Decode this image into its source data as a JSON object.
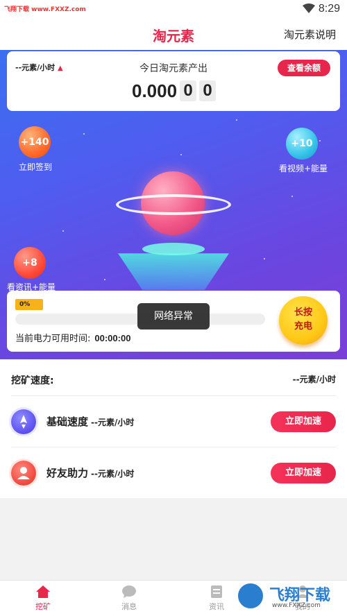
{
  "status_bar": {
    "watermark": "飞翔下载 www.FXXZ.com",
    "time": "8:29"
  },
  "header": {
    "title": "淘元素",
    "explain_link": "淘元素说明"
  },
  "output_card": {
    "rate": "--元素/小时",
    "title": "今日淘元素产出",
    "balance_button": "查看余额",
    "value_main": "0.000",
    "value_digit1": "0",
    "value_digit2": "0"
  },
  "bubbles": {
    "signin_value": "+140",
    "signin_label": "立即签到",
    "video_value": "+10",
    "video_label": "看视频+能量",
    "news_value": "+8",
    "news_label": "看资讯+能量"
  },
  "power": {
    "percent_label": "0%",
    "progress": 0,
    "time_label": "当前电力可用时间:",
    "time_value": "00:00:00",
    "charge_button_line1": "长按",
    "charge_button_line2": "充电"
  },
  "toast": "网络异常",
  "speed": {
    "header": "挖矿速度:",
    "total": "--元素/小时",
    "rows": [
      {
        "title": "基础速度",
        "rate": "--元素/小时",
        "button": "立即加速",
        "icon": "rocket-icon"
      },
      {
        "title": "好友助力",
        "rate": "--元素/小时",
        "button": "立即加速",
        "icon": "user-icon"
      }
    ]
  },
  "tabs": [
    {
      "label": "挖矿",
      "icon": "home-icon",
      "active": true
    },
    {
      "label": "消息",
      "icon": "chat-icon",
      "active": false
    },
    {
      "label": "资讯",
      "icon": "news-icon",
      "active": false
    },
    {
      "label": "我的",
      "icon": "profile-icon",
      "active": false
    }
  ],
  "brand_logo": {
    "text": "飞翔下载",
    "sub": "www.FXXZ.com"
  },
  "colors": {
    "accent": "#e8254a",
    "gold": "#f7b21a",
    "hero_start": "#3a6ff0",
    "hero_end": "#7a3fd8"
  }
}
